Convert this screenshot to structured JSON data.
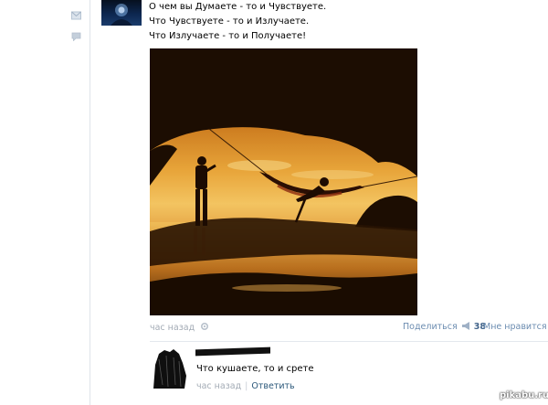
{
  "post": {
    "lines": [
      "О чем вы Думаете - то и Чувствуете.",
      "Что Чувствуете - то и Излучаете.",
      "Что Излучаете - то и Получаете!"
    ],
    "time": "час назад",
    "share_label": "Поделиться",
    "share_count": "38",
    "like_label": "Мне нравится"
  },
  "comment": {
    "text": "Что кушаете, то и срете",
    "time": "час назад",
    "reply_label": "Ответить"
  },
  "watermark": "pikabu.ru",
  "sidebar": {
    "icons": [
      "mail-icon",
      "comment-icon"
    ]
  },
  "colors": {
    "link": "#2b587a",
    "meta": "#a3abb5",
    "divider": "#dfe4ea",
    "share_count": "#43658b"
  }
}
